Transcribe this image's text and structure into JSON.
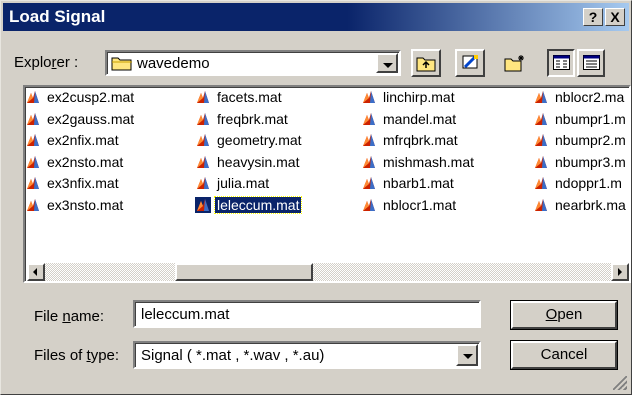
{
  "window": {
    "title": "Load Signal",
    "help_label": "?",
    "close_label": "X"
  },
  "explorer": {
    "label_pre": "Explo",
    "label_underline": "r",
    "label_post": "er :",
    "current_folder": "wavedemo"
  },
  "toolbar": {
    "icons": [
      "up-folder-icon",
      "desktop-icon",
      "new-folder-icon",
      "list-view-icon",
      "details-view-icon"
    ]
  },
  "files": {
    "columns": [
      [
        "ex2cusp2.mat",
        "ex2gauss.mat",
        "ex2nfix.mat",
        "ex2nsto.mat",
        "ex3nfix.mat",
        "ex3nsto.mat"
      ],
      [
        "facets.mat",
        "freqbrk.mat",
        "geometry.mat",
        "heavysin.mat",
        "julia.mat",
        "leleccum.mat"
      ],
      [
        "linchirp.mat",
        "mandel.mat",
        "mfrqbrk.mat",
        "mishmash.mat",
        "nbarb1.mat",
        "nblocr1.mat"
      ],
      [
        "nblocr2.ma",
        "nbumpr1.m",
        "nbumpr2.m",
        "nbumpr3.m",
        "ndoppr1.m",
        "nearbrk.ma"
      ]
    ],
    "selected": "leleccum.mat"
  },
  "filename": {
    "label_pre": "File ",
    "label_underline": "n",
    "label_post": "ame:",
    "value": "leleccum.mat"
  },
  "filetype": {
    "label_pre": "Files of ",
    "label_underline": "t",
    "label_post": "ype:",
    "value": "Signal ( *.mat , *.wav , *.au)"
  },
  "buttons": {
    "open_underline": "O",
    "open_rest": "pen",
    "cancel": "Cancel"
  }
}
